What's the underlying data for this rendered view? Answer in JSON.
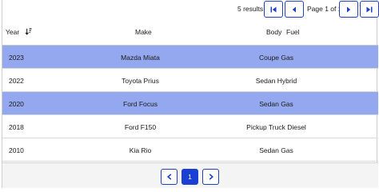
{
  "pagination_top": {
    "results_text": "5 results",
    "page_text": "Page 1 of 1"
  },
  "table": {
    "columns": [
      "Year",
      "Make",
      "Body",
      "Fuel"
    ],
    "rows": [
      {
        "year": "2023",
        "make": "Mazda Miata",
        "body": "Coupe",
        "fuel": "Gas",
        "selected": true
      },
      {
        "year": "2022",
        "make": "Toyota Prius",
        "body": "Sedan",
        "fuel": "Hybrid",
        "selected": false
      },
      {
        "year": "2020",
        "make": "Ford Focus",
        "body": "Sedan",
        "fuel": "Gas",
        "selected": true
      },
      {
        "year": "2018",
        "make": "Ford F150",
        "body": "Pickup Truck",
        "fuel": "Diesel",
        "selected": false
      },
      {
        "year": "2010",
        "make": "Kia Rio",
        "body": "Sedan",
        "fuel": "Gas",
        "selected": false
      }
    ]
  },
  "pagination_bottom": {
    "current_page": "1"
  },
  "colors": {
    "accent": "#1c3fd3",
    "selected_row": "#93a8ef"
  },
  "icons": [
    "first-page-icon",
    "previous-page-icon",
    "next-page-icon",
    "last-page-icon",
    "sort-descending-icon"
  ]
}
